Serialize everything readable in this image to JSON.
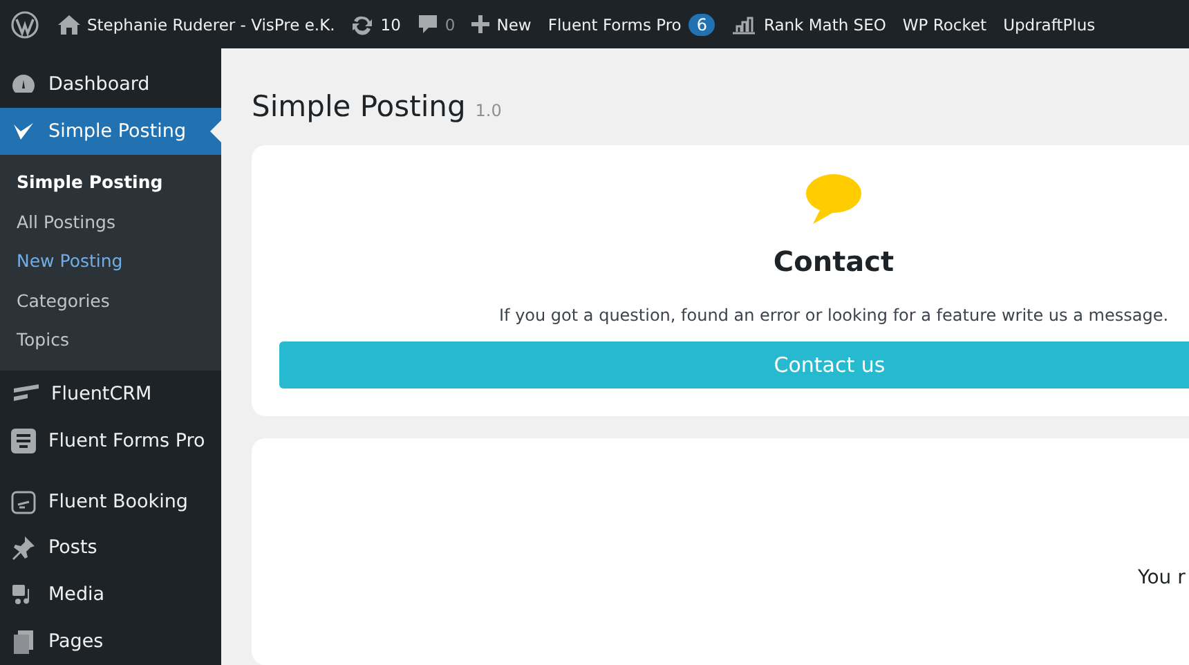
{
  "admin_bar": {
    "site_name": "Stephanie Ruderer - VisPre e.K.",
    "updates": "10",
    "comments": "0",
    "new": "New",
    "items": [
      {
        "label": "Fluent Forms Pro",
        "badge": "6",
        "kind": "badge"
      },
      {
        "label": "Rank Math SEO",
        "kind": "icon"
      },
      {
        "label": "WP Rocket",
        "kind": "plain"
      },
      {
        "label": "UpdraftPlus",
        "kind": "plain"
      }
    ]
  },
  "sidebar": {
    "items": [
      {
        "label": "Dashboard",
        "kind": "dashboard",
        "selected": false
      },
      {
        "label": "Simple Posting",
        "kind": "check",
        "selected": true,
        "children": [
          {
            "label": "Simple Posting",
            "selected": false,
            "kind": "heading"
          },
          {
            "label": "All Postings",
            "selected": false,
            "kind": "link"
          },
          {
            "label": "New Posting",
            "selected": true,
            "kind": "link"
          },
          {
            "label": "Categories",
            "selected": false,
            "kind": "link"
          },
          {
            "label": "Topics",
            "selected": false,
            "kind": "link"
          }
        ]
      },
      {
        "label": "FluentCRM",
        "kind": "crm",
        "selected": false
      },
      {
        "label": "Fluent Forms Pro",
        "kind": "forms",
        "selected": false
      },
      {
        "label": "Fluent Booking",
        "kind": "booking",
        "selected": false
      },
      {
        "label": "Posts",
        "kind": "pin",
        "selected": false
      },
      {
        "label": "Media",
        "kind": "media",
        "selected": false
      },
      {
        "label": "Pages",
        "kind": "pages",
        "selected": false
      }
    ]
  },
  "page": {
    "title": "Simple Posting",
    "version": "1.0",
    "contact": {
      "heading": "Contact",
      "text": "If you got a question, found an error or looking for a feature write us a message.",
      "button": "Contact us"
    },
    "second_card": {
      "text": "You r"
    }
  }
}
